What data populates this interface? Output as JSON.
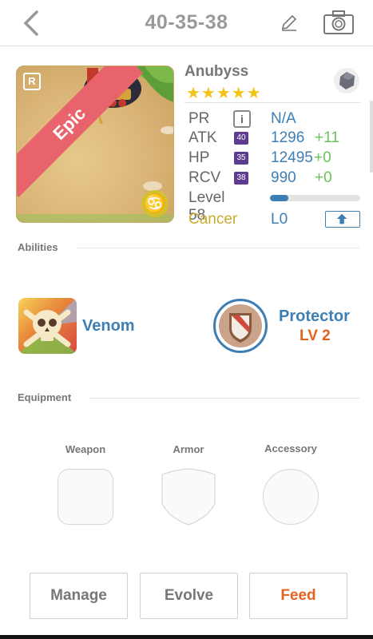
{
  "header": {
    "title": "40-35-38"
  },
  "monster": {
    "name": "Anubyss",
    "stars": "★★★★★",
    "rarity": "Epic",
    "rank_badge": "R",
    "zodiac_symbol": "♋"
  },
  "stats": {
    "pr": {
      "label": "PR",
      "info": "i",
      "value": "N/A"
    },
    "atk": {
      "label": "ATK",
      "level": "40",
      "value": "1296",
      "bonus": "+11"
    },
    "hp": {
      "label": "HP",
      "level": "35",
      "value": "12495",
      "bonus": "+0"
    },
    "rcv": {
      "label": "RCV",
      "level": "38",
      "value": "990",
      "bonus": "+0"
    },
    "level": {
      "label": "Level 58",
      "progress": 0.2
    },
    "zodiac": {
      "label": "Cancer",
      "value": "L0"
    }
  },
  "abilities": {
    "section_label": "Abilities",
    "items": [
      {
        "name": "Venom"
      },
      {
        "name": "Protector",
        "level": "LV 2"
      }
    ]
  },
  "equipment": {
    "section_label": "Equipment",
    "slots": {
      "weapon": "Weapon",
      "armor": "Armor",
      "accessory": "Accessory"
    }
  },
  "actions": {
    "manage": "Manage",
    "evolve": "Evolve",
    "feed": "Feed"
  },
  "colors": {
    "accent_blue": "#3d7fb5",
    "bonus_green": "#6cc25c",
    "feed_orange": "#e2641f",
    "epic_red": "#e8636b",
    "star_gold": "#f2c318"
  }
}
